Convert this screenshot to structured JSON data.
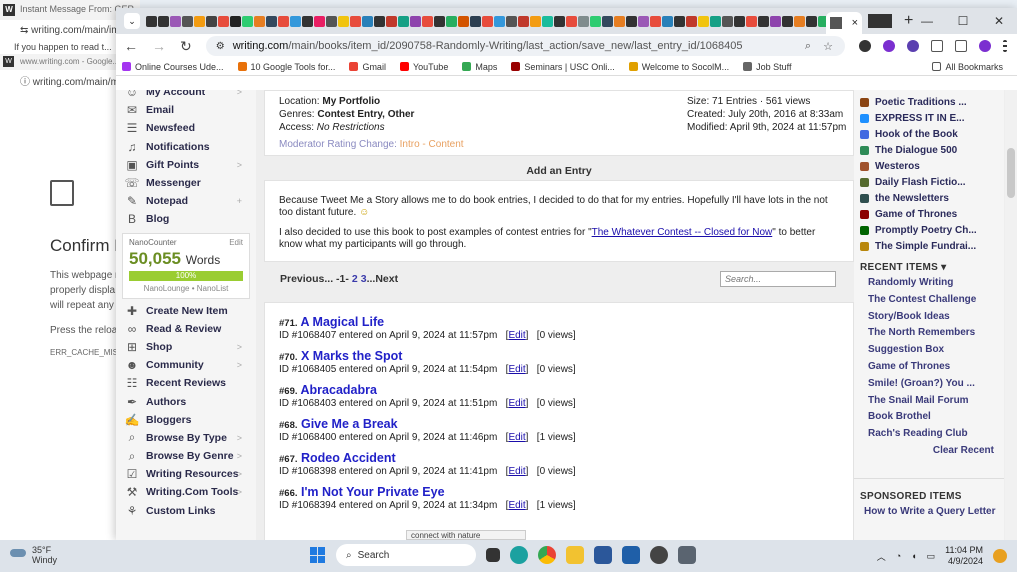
{
  "background_window": {
    "tab_title": "Instant Message From: GER...",
    "url": "writing.com/main/im",
    "cut_text": "If you happen to read t...",
    "tab_title_2": "www.writing.com - Google...",
    "url_2": "writing.com/main/my",
    "error": {
      "title": "Confirm F",
      "line1": "This webpage r",
      "line2": "properly displa",
      "line3": "will repeat any",
      "line4": "Press the reloa",
      "code": "ERR_CACHE_MISS"
    }
  },
  "browser": {
    "active_tab_close": "×",
    "new_tab": "+",
    "window_controls": {
      "minimize": "—",
      "maximize": "☐",
      "close": "✕"
    },
    "url_host": "writing.com",
    "url_path": "/main/books/item_id/2090758-Randomly-Writing/last_action/save_new/last_entry_id/1068405",
    "bookmarks": [
      {
        "label": "Online Courses Ude...",
        "color": "#a435f0"
      },
      {
        "label": "10 Google Tools for...",
        "color": "#e8710a"
      },
      {
        "label": "Gmail",
        "color": "#ea4335"
      },
      {
        "label": "YouTube",
        "color": "#ff0000"
      },
      {
        "label": "Maps",
        "color": "#34a853"
      },
      {
        "label": "Seminars | USC Onli...",
        "color": "#990000"
      },
      {
        "label": "Welcome to SocolM...",
        "color": "#e0a000"
      },
      {
        "label": "Job Stuff",
        "color": "#666666"
      }
    ],
    "all_bookmarks": "All Bookmarks"
  },
  "left_nav": {
    "items_top": [
      {
        "label": "My Account",
        "icon": "user-icon",
        "glyph": "☺",
        "arrow": ">"
      },
      {
        "label": "Email",
        "icon": "mail-icon",
        "glyph": "✉",
        "arrow": ""
      },
      {
        "label": "Newsfeed",
        "icon": "people-icon",
        "glyph": "☰",
        "arrow": ""
      },
      {
        "label": "Notifications",
        "icon": "bell-icon",
        "glyph": "♫",
        "arrow": ""
      },
      {
        "label": "Gift Points",
        "icon": "gift-icon",
        "glyph": "▣",
        "arrow": ">"
      },
      {
        "label": "Messenger",
        "icon": "chat-icon",
        "glyph": "☏",
        "arrow": ""
      },
      {
        "label": "Notepad",
        "icon": "notepad-icon",
        "glyph": "✎",
        "arrow": "+"
      },
      {
        "label": "Blog",
        "icon": "blog-icon",
        "glyph": "B",
        "arrow": ""
      }
    ],
    "counter": {
      "label": "NanoCounter",
      "edit": "Edit",
      "number": "50,055",
      "unit": "Words",
      "percent": "100%",
      "links": "NanoLounge • NanoList"
    },
    "items_bottom": [
      {
        "label": "Create New Item",
        "icon": "plus-icon",
        "glyph": "✚",
        "arrow": ""
      },
      {
        "label": "Read & Review",
        "icon": "glasses-icon",
        "glyph": "∞",
        "arrow": ""
      },
      {
        "label": "Shop",
        "icon": "cart-icon",
        "glyph": "⊞",
        "arrow": ">"
      },
      {
        "label": "Community",
        "icon": "community-icon",
        "glyph": "☻",
        "arrow": ">"
      },
      {
        "label": "Recent Reviews",
        "icon": "reviews-icon",
        "glyph": "☷",
        "arrow": ""
      },
      {
        "label": "Authors",
        "icon": "quill-icon",
        "glyph": "✒",
        "arrow": ""
      },
      {
        "label": "Bloggers",
        "icon": "bloggers-icon",
        "glyph": "✍",
        "arrow": ""
      },
      {
        "label": "Browse By Type",
        "icon": "magnifier-icon",
        "glyph": "⌕",
        "arrow": ">"
      },
      {
        "label": "Browse By Genre",
        "icon": "magnifier-genre-icon",
        "glyph": "⌕",
        "arrow": ">"
      },
      {
        "label": "Writing Resources",
        "icon": "resources-icon",
        "glyph": "☑",
        "arrow": ">"
      },
      {
        "label": "Writing.Com Tools",
        "icon": "tools-icon",
        "glyph": "⚒",
        "arrow": ">"
      },
      {
        "label": "Custom Links",
        "icon": "links-icon",
        "glyph": "⚘",
        "arrow": ""
      }
    ]
  },
  "book_info": {
    "location_label": "Location:",
    "location": "My Portfolio",
    "genres_label": "Genres:",
    "genres": "Contest Entry, Other",
    "access_label": "Access:",
    "access": "No Restrictions",
    "moderator": "Moderator",
    "rating_change": " Rating Change: ",
    "rating_value": "Intro - Content",
    "size": "Size: 71 Entries · 561 views",
    "created": "Created: July 20th, 2016 at 8:33am",
    "modified": "Modified: April 9th, 2024 at 11:57pm"
  },
  "add_entry_label": "Add an Entry",
  "intro": {
    "para1": "Because Tweet Me a Story allows me to do book entries, I decided to do that for my entries. Hopefully I'll have lots in the not too distant future.",
    "para2_pre": "I also decided to use this book to post examples of contest entries for \"",
    "para2_link": "The Whatever Contest -- Closed for Now",
    "para2_post": "\" to better know what my participants will go through."
  },
  "pager": {
    "previous": "Previous",
    "sep": " ... -",
    "current": "1",
    "sep2": "- ",
    "pages": [
      "2",
      "3"
    ],
    "ellipsis": " ... ",
    "next": "Next",
    "search_placeholder": "Search..."
  },
  "entries": [
    {
      "num": "#71.",
      "title": "A Magical Life",
      "meta": "ID #1068407 entered on April 9, 2024 at 11:57pm",
      "edit": "Edit",
      "views": "[0 views]"
    },
    {
      "num": "#70.",
      "title": "X Marks the Spot",
      "meta": "ID #1068405 entered on April 9, 2024 at 11:54pm",
      "edit": "Edit",
      "views": "[0 views]"
    },
    {
      "num": "#69.",
      "title": "Abracadabra",
      "meta": "ID #1068403 entered on April 9, 2024 at 11:51pm",
      "edit": "Edit",
      "views": "[0 views]"
    },
    {
      "num": "#68.",
      "title": "Give Me a Break",
      "meta": "ID #1068400 entered on April 9, 2024 at 11:46pm",
      "edit": "Edit",
      "views": "[1 views]"
    },
    {
      "num": "#67.",
      "title": "Rodeo Accident",
      "meta": "ID #1068398 entered on April 9, 2024 at 11:41pm",
      "edit": "Edit",
      "views": "[0 views]"
    },
    {
      "num": "#66.",
      "title": "I'm Not Your Private Eye",
      "meta": "ID #1068394 entered on April 9, 2024 at 11:34pm",
      "edit": "Edit",
      "views": "[1 views]"
    }
  ],
  "right_col": {
    "favorites": [
      {
        "label": "Poetic Traditions ...",
        "color": "#8b4513"
      },
      {
        "label": "EXPRESS IT IN E...",
        "color": "#1e90ff"
      },
      {
        "label": "Hook of the Book",
        "color": "#4169e1"
      },
      {
        "label": "The Dialogue 500",
        "color": "#2e8b57"
      },
      {
        "label": "Westeros",
        "color": "#a0522d"
      },
      {
        "label": "Daily Flash Fictio...",
        "color": "#556b2f"
      },
      {
        "label": "the Newsletters",
        "color": "#2f4f4f"
      },
      {
        "label": "Game of Thrones",
        "color": "#8b0000"
      },
      {
        "label": "Promptly Poetry Ch...",
        "color": "#006400"
      },
      {
        "label": "The Simple Fundrai...",
        "color": "#b8860b"
      }
    ],
    "recent_header": "RECENT ITEMS",
    "recent": [
      "Randomly Writing",
      "The Contest Challenge",
      "Story/Book Ideas",
      "The North Remembers",
      "Suggestion Box",
      "Game of Thrones",
      "Smile! (Groan?) You ...",
      "The Snail Mail Forum",
      "Book Brothel",
      "Rach's Reading Club"
    ],
    "clear_recent": "Clear Recent",
    "sponsored_header": "SPONSORED ITEMS",
    "sponsored": [
      "How to Write a Query Letter"
    ]
  },
  "hscroll_text": "connect with nature",
  "taskbar": {
    "temp": "35°F",
    "condition": "Windy",
    "search": "Search",
    "time": "11:04 PM",
    "date": "4/9/2024"
  }
}
